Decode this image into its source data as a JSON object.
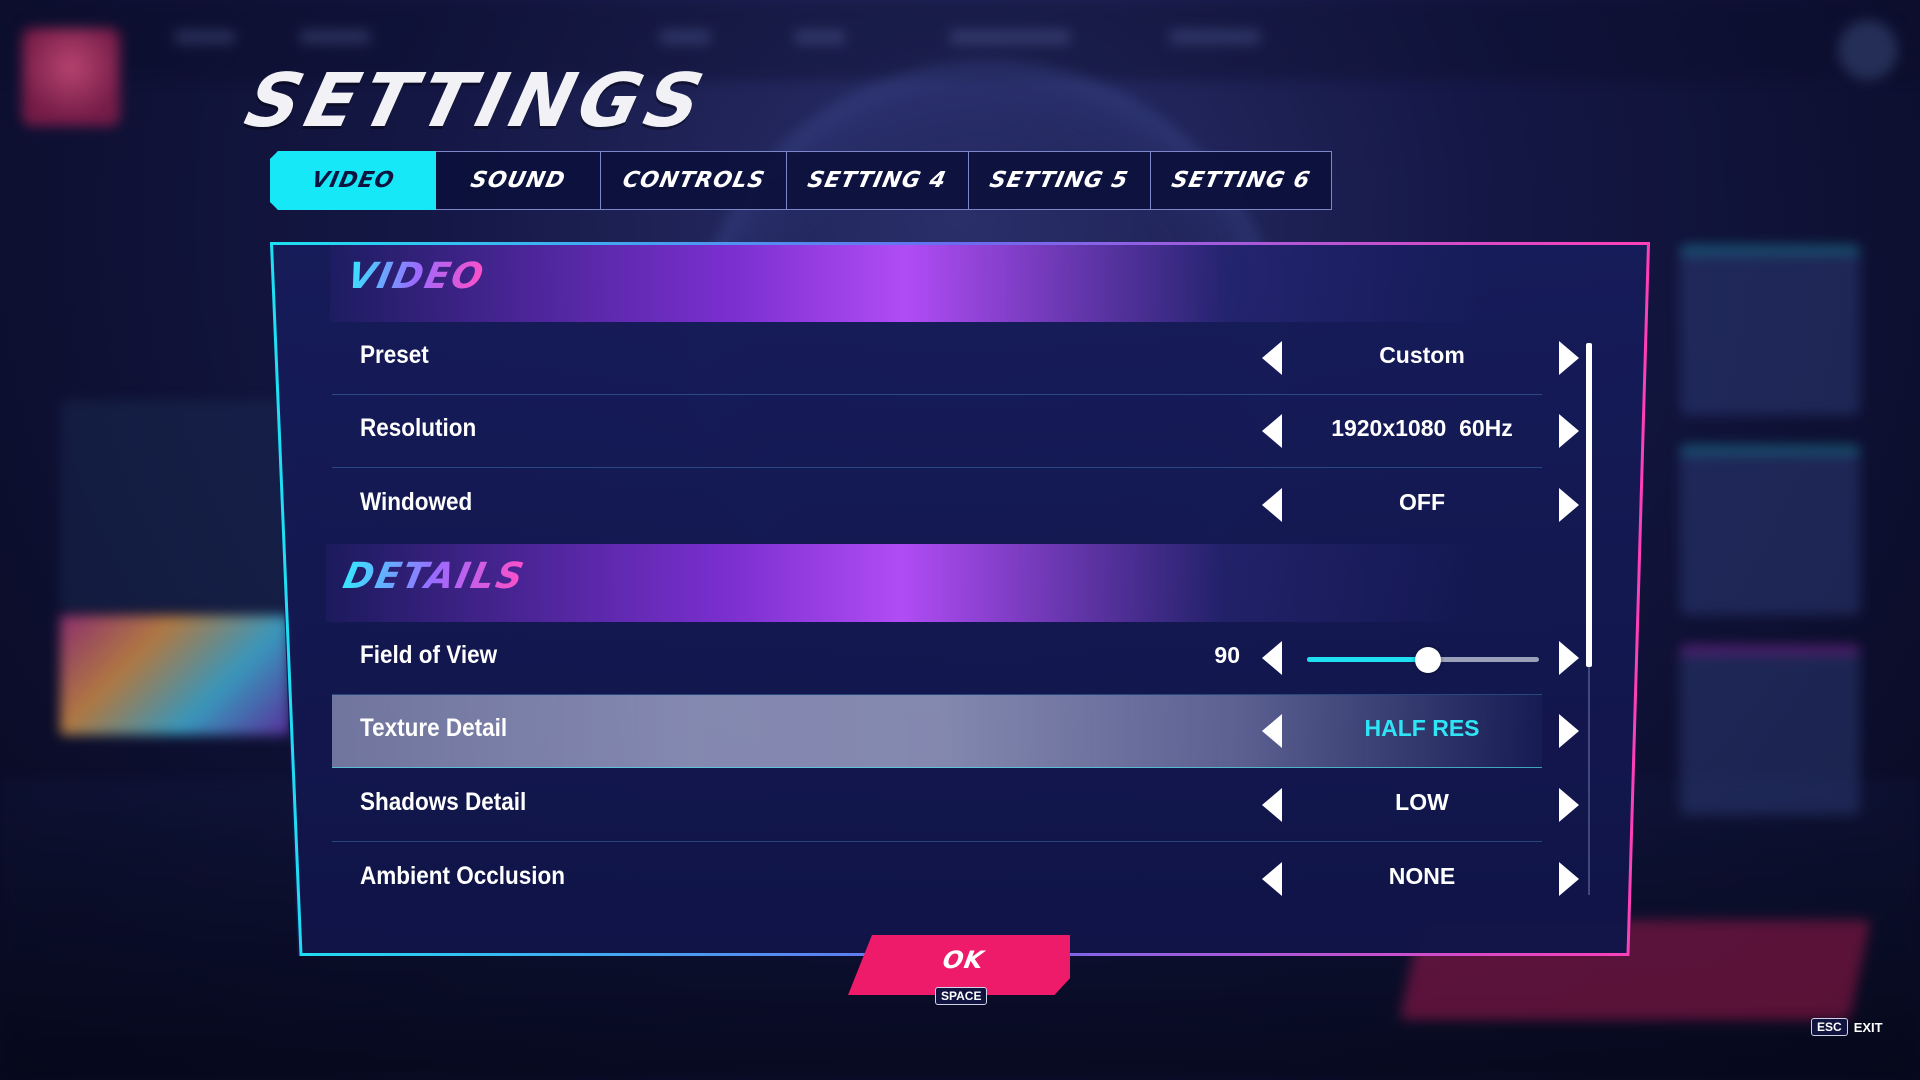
{
  "title": "SETTINGS",
  "tabs": [
    {
      "label": "VIDEO",
      "active": true
    },
    {
      "label": "SOUND",
      "active": false
    },
    {
      "label": "CONTROLS",
      "active": false
    },
    {
      "label": "SETTING 4",
      "active": false
    },
    {
      "label": "SETTING 5",
      "active": false
    },
    {
      "label": "SETTING 6",
      "active": false
    }
  ],
  "sections": {
    "video": {
      "title": "VIDEO",
      "rows": [
        {
          "label": "Preset",
          "value": "Custom"
        },
        {
          "label": "Resolution",
          "value": "1920x1080  60Hz"
        },
        {
          "label": "Windowed",
          "value": "OFF"
        }
      ]
    },
    "details": {
      "title": "DETAILS",
      "fov": {
        "label": "Field of View",
        "value": "90",
        "slider_fraction": 0.52
      },
      "rows": [
        {
          "label": "Texture Detail",
          "value": "HALF RES",
          "selected": true
        },
        {
          "label": "Shadows Detail",
          "value": "LOW"
        },
        {
          "label": "Ambient Occlusion",
          "value": "NONE"
        }
      ]
    }
  },
  "ok_button": {
    "label": "OK",
    "hint": "SPACE"
  },
  "exit": {
    "key": "ESC",
    "label": "EXIT"
  },
  "colors": {
    "accent_cyan": "#17e8f7",
    "accent_pink": "#ee1a6a",
    "section_purple": "#b14cf5",
    "panel_bg": "#161c5a"
  },
  "icons": {
    "left_arrow": "left-triangle",
    "right_arrow": "right-triangle"
  }
}
